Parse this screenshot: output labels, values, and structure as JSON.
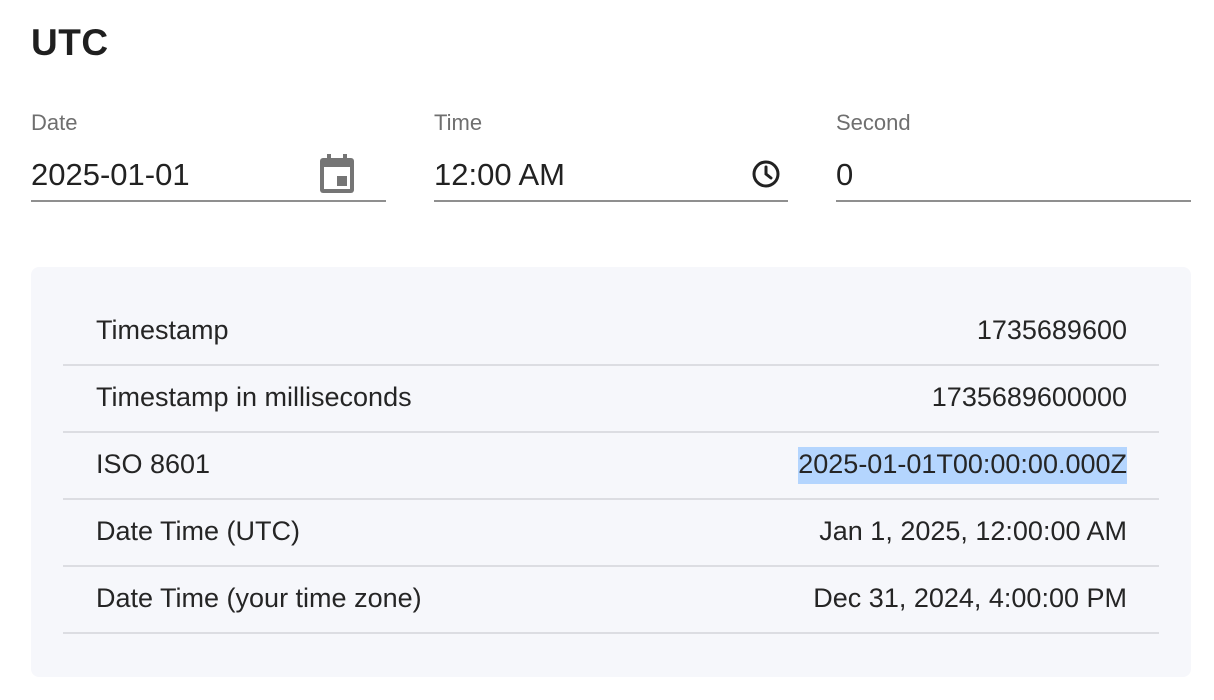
{
  "title": "UTC",
  "fields": {
    "date": {
      "label": "Date",
      "value": "2025-01-01",
      "icon": "calendar-icon"
    },
    "time": {
      "label": "Time",
      "value": "12:00 AM",
      "icon": "clock-icon"
    },
    "second": {
      "label": "Second",
      "value": "0"
    }
  },
  "results": [
    {
      "label": "Timestamp",
      "value": "1735689600"
    },
    {
      "label": "Timestamp in milliseconds",
      "value": "1735689600000"
    },
    {
      "label": "ISO 8601",
      "value": "2025-01-01T00:00:00.000Z"
    },
    {
      "label": "Date Time (UTC)",
      "value": "Jan 1, 2025, 12:00:00 AM"
    },
    {
      "label": "Date Time (your time zone)",
      "value": "Dec 31, 2024, 4:00:00 PM"
    }
  ],
  "colors": {
    "selection": "#b4d5fe",
    "panel_bg": "#f6f7fb",
    "underline": "#8f8f8f"
  }
}
